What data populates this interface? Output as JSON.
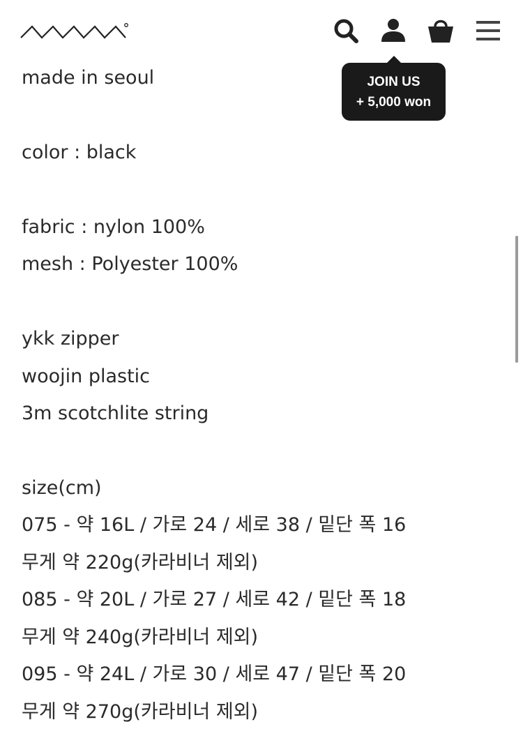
{
  "header": {
    "logo_icon": "zigzag-mountain-logo",
    "icons": {
      "search": "search-icon",
      "account": "user-icon",
      "cart": "shopping-bag-icon",
      "menu": "hamburger-menu-icon"
    }
  },
  "tooltip": {
    "line1": "JOIN US",
    "line2": "+ 5,000 won"
  },
  "description": {
    "origin": "made in seoul",
    "color": "color : black",
    "fabric": "fabric : nylon 100%",
    "mesh": "mesh : Polyester 100%",
    "zipper": "ykk zipper",
    "plastic": "woojin plastic",
    "string": "3m scotchlite string",
    "size_heading": "size(cm)",
    "sizes": [
      {
        "dims": "075 - 약 16L / 가로 24 / 세로 38 / 밑단 폭 16",
        "weight": "무게 약 220g(카라비너 제외)"
      },
      {
        "dims": "085 - 약 20L / 가로 27 / 세로 42 / 밑단 폭 18",
        "weight": "무게 약 240g(카라비너 제외)"
      },
      {
        "dims": "095 - 약 24L / 가로 30 / 세로 47 / 밑단 폭 20",
        "weight": "무게 약 270g(카라비너 제외)"
      }
    ]
  },
  "colors": {
    "text": "#2a2a2a",
    "tooltip_bg": "#1a1a1a",
    "tooltip_text": "#ffffff",
    "icon": "#222222"
  }
}
